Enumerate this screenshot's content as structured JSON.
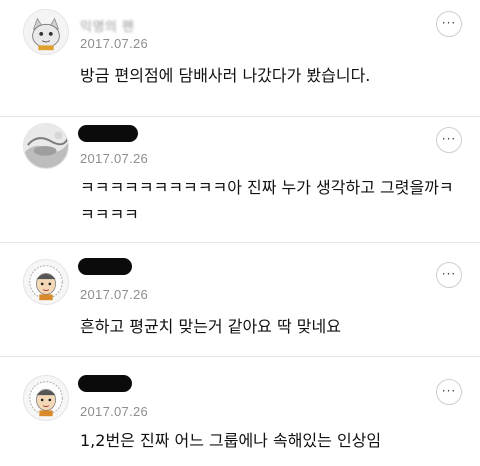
{
  "comments": [
    {
      "author": "익명의 팬",
      "date": "2017.07.26",
      "text": "방금 편의점에 담배사러 나갔다가 봤습니다.",
      "more_icon": "more-horizontal-icon",
      "more_label": "···"
    },
    {
      "author": "",
      "date": "2017.07.26",
      "text": "ㅋㅋㅋㅋㅋㅋㅋㅋㅋㅋ아 진짜 누가 생각하고 그렷을까ㅋ\nㅋㅋㅋㅋ",
      "more_icon": "more-horizontal-icon",
      "more_label": "···"
    },
    {
      "author": "",
      "date": "2017.07.26",
      "text": "흔하고 평균치 맞는거 같아요 딱 맞네요",
      "more_icon": "more-horizontal-icon",
      "more_label": "···"
    },
    {
      "author": "",
      "date": "2017.07.26",
      "text": "1,2번은 진짜 어느 그룹에나 속해있는 인상임",
      "more_icon": "more-horizontal-icon",
      "more_label": "···"
    }
  ],
  "colors": {
    "divider": "#e6e6e6",
    "date": "#8e8e8e",
    "text": "#111111"
  }
}
